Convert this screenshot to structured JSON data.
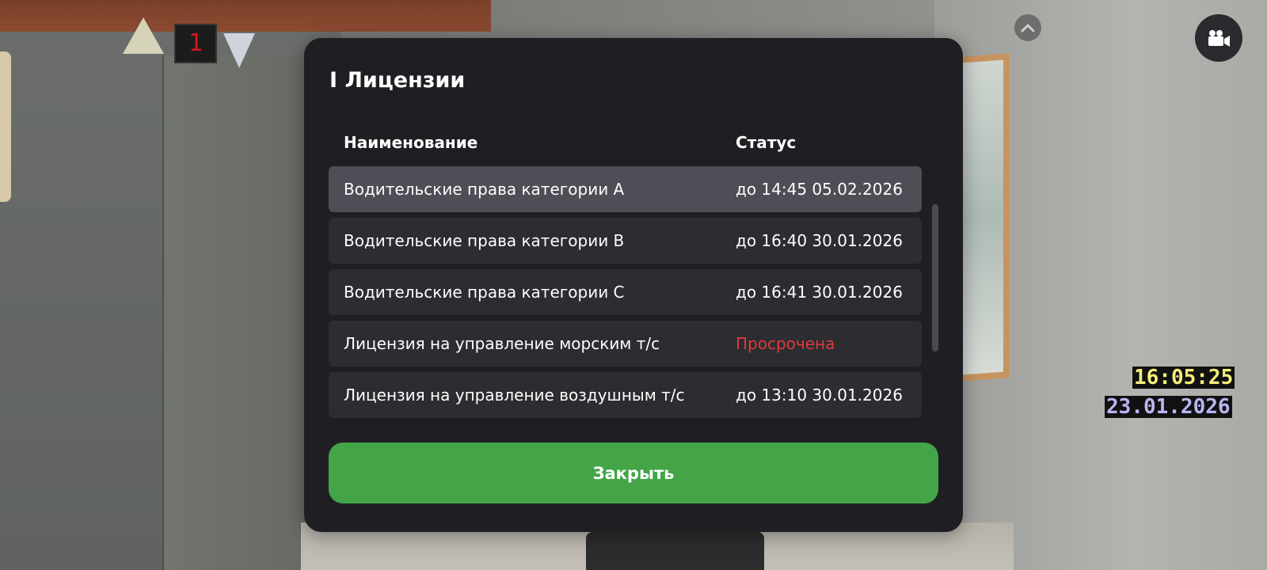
{
  "hud": {
    "floor_number": "1",
    "time": "16:05:25",
    "date": "23.01.2026",
    "top_button_icon": "chevron-up-icon",
    "camera_button_icon": "video-camera-icon"
  },
  "modal": {
    "title": "I Лицензии",
    "columns": {
      "name": "Наименование",
      "status": "Статус"
    },
    "rows": [
      {
        "name": "Водительские права категории A",
        "status": "до 14:45 05.02.2026",
        "selected": true,
        "expired": false
      },
      {
        "name": "Водительские права категории B",
        "status": "до 16:40 30.01.2026",
        "selected": false,
        "expired": false
      },
      {
        "name": "Водительские права категории C",
        "status": "до 16:41 30.01.2026",
        "selected": false,
        "expired": false
      },
      {
        "name": "Лицензия на управление морским т/с",
        "status": "Просрочена",
        "selected": false,
        "expired": true
      },
      {
        "name": "Лицензия на управление воздушным т/с",
        "status": "до 13:10 30.01.2026",
        "selected": false,
        "expired": false
      }
    ],
    "close_label": "Закрыть"
  },
  "colors": {
    "modal_bg": "#1f1f23",
    "row_bg": "#2c2c31",
    "row_selected_bg": "#4d4e56",
    "expired": "#e0393c",
    "close_button": "#43a548",
    "clock_text": "#f3ee7a",
    "date_text": "#b9b6f2"
  }
}
